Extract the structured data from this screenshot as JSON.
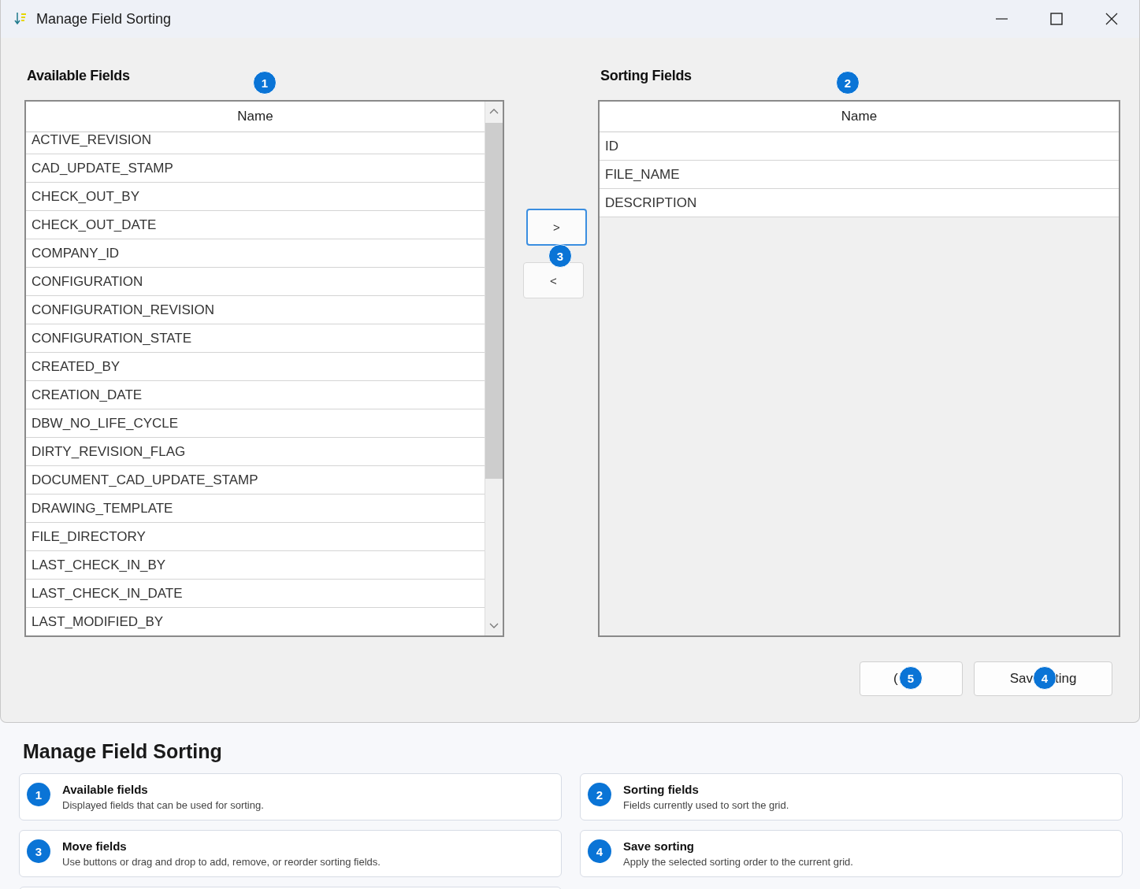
{
  "window": {
    "title": "Manage Field Sorting"
  },
  "available": {
    "heading": "Available Fields",
    "column": "Name",
    "rows": [
      "ACTIVE_REVISION",
      "CAD_UPDATE_STAMP",
      "CHECK_OUT_BY",
      "CHECK_OUT_DATE",
      "COMPANY_ID",
      "CONFIGURATION",
      "CONFIGURATION_REVISION",
      "CONFIGURATION_STATE",
      "CREATED_BY",
      "CREATION_DATE",
      "DBW_NO_LIFE_CYCLE",
      "DIRTY_REVISION_FLAG",
      "DOCUMENT_CAD_UPDATE_STAMP",
      "DRAWING_TEMPLATE",
      "FILE_DIRECTORY",
      "LAST_CHECK_IN_BY",
      "LAST_CHECK_IN_DATE",
      "LAST_MODIFIED_BY"
    ]
  },
  "sorting": {
    "heading": "Sorting Fields",
    "column": "Name",
    "rows": [
      "ID",
      "FILE_NAME",
      "DESCRIPTION"
    ]
  },
  "move_buttons": [
    {
      "label": ">",
      "focused": true
    },
    {
      "label": "<",
      "focused": false
    }
  ],
  "action_buttons": [
    {
      "label_parts": [
        "("
      ]
    },
    {
      "label_parts": [
        "Sav",
        "ting"
      ]
    }
  ],
  "badges": [
    "1",
    "2",
    "3",
    "4",
    "5"
  ],
  "guide": {
    "title": "Manage Field Sorting",
    "items": [
      {
        "number": "1",
        "title": "Available fields",
        "description": "Displayed fields that can be used for sorting."
      },
      {
        "number": "2",
        "title": "Sorting fields",
        "description": "Fields currently used to sort the grid."
      },
      {
        "number": "3",
        "title": "Move fields",
        "description": "Use buttons or drag and drop to add, remove, or reorder sorting fields."
      },
      {
        "number": "4",
        "title": "Save sorting",
        "description": "Apply the selected sorting order to the current grid."
      }
    ]
  }
}
